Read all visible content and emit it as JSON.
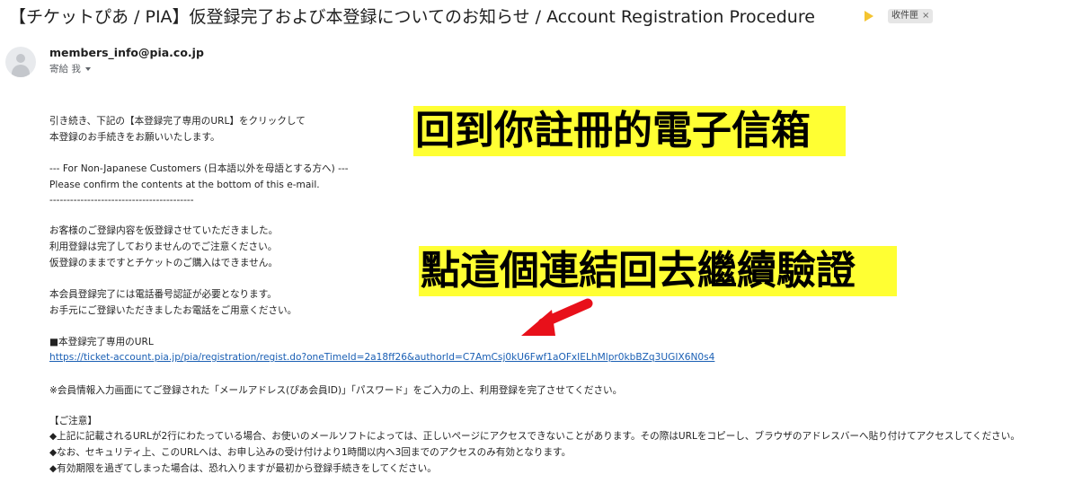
{
  "email": {
    "subject": "【チケットぴあ / PIA】仮登録完了および本登録についてのお知らせ / Account Registration Procedure",
    "label_chip": "收件匣",
    "label_close": "×",
    "sender": "members_info@pia.co.jp",
    "to_line": "寄給 我",
    "body": {
      "p1": [
        "引き続き、下記の【本登録完了専用のURL】をクリックして",
        "本登録のお手続きをお願いいたします。"
      ],
      "p2": [
        "--- For Non-Japanese Customers (日本語以外を母語とする方へ) ---",
        "Please confirm the contents at the bottom of this e-mail.",
        "------------------------------------------"
      ],
      "p3": [
        "お客様のご登録内容を仮登録させていただきました。",
        "利用登録は完了しておりませんのでご注意ください。",
        "仮登録のままですとチケットのご購入はできません。"
      ],
      "p4": [
        "本会員登録完了には電話番号認証が必要となります。",
        "お手元にご登録いただきましたお電話をご用意ください。"
      ],
      "url_heading": "■本登録完了専用のURL",
      "url": "https://ticket-account.pia.jp/pia/registration/regist.do?oneTimeId=2a18ff26&authorId=C7AmCsj0kU6Fwf1aOFxIELhMlpr0kbBZq3UGIX6N0s4",
      "note": "※会員情報入力画面にてご登録された「メールアドレス(ぴあ会員ID)」「パスワード」をご入力の上、利用登録を完了させてください。",
      "caution_heading": "【ご注意】",
      "caution": [
        "◆上記に記載されるURLが2行にわたっている場合、お使いのメールソフトによっては、正しいページにアクセスできないことがあります。その際はURLをコピーし、ブラウザのアドレスバーへ貼り付けてアクセスしてください。",
        "◆なお、セキュリティ上、このURLへは、お申し込みの受け付けより1時間以内へ3回までのアクセスのみ有効となります。",
        "◆有効期限を過ぎてしまった場合は、恐れ入りますが最初から登録手続きをしてください。"
      ]
    }
  },
  "annotations": {
    "callout_1": "回到你註冊的電子信箱",
    "callout_2": "點這個連結回去繼續驗證",
    "highlight_color": "#ffff33",
    "arrow_color": "#e8101a"
  },
  "icons": {
    "importance": "importance-marker-icon",
    "avatar": "avatar-icon",
    "caret": "caret-down-icon",
    "arrow": "red-arrow-icon"
  }
}
